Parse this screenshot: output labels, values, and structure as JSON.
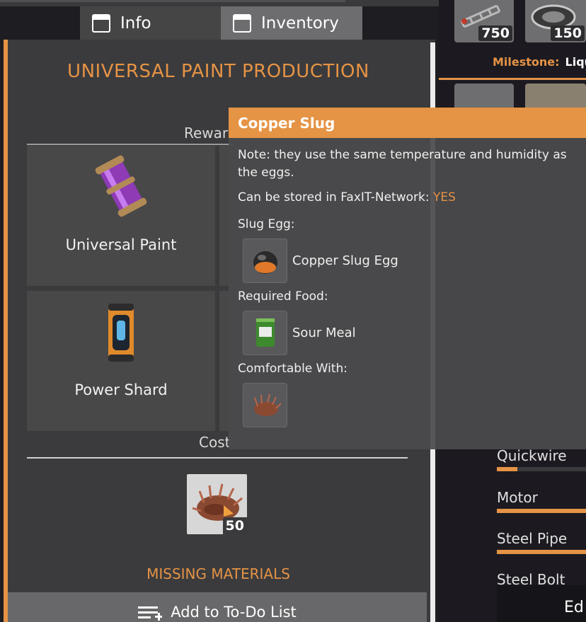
{
  "tabs": [
    {
      "label": "Info",
      "icon": "window-icon"
    },
    {
      "label": "Inventory",
      "icon": "window-icon"
    }
  ],
  "panel": {
    "title": "UNIVERSAL PAINT PRODUCTION",
    "rewards_label": "Rewar",
    "rewards": [
      {
        "name": "Universal Paint",
        "icon": "paint-canister-icon"
      },
      {
        "name": "Power Shard",
        "icon": "power-shard-icon"
      }
    ],
    "cost_label": "Cost",
    "cost_item": {
      "icon": "copper-slug-icon",
      "count": "50"
    },
    "missing_materials": "MISSING MATERIALS",
    "todo_button": "Add to To-Do List"
  },
  "tooltip": {
    "title": "Copper Slug",
    "note": "Note: they use the same temperature and humidity as the eggs.",
    "storage_label": "Can be stored in FaxIT-Network: ",
    "storage_value": "YES",
    "slug_egg_label": "Slug Egg:",
    "slug_egg_item": "Copper Slug Egg",
    "food_label": "Required Food:",
    "food_item": "Sour Meal",
    "comfort_label": "Comfortable With:",
    "comfort_icon": "copper-slug-icon"
  },
  "right_panel": {
    "top_items": [
      {
        "icon": "truss-frame-icon",
        "count": "750"
      },
      {
        "icon": "engine-part-icon",
        "count": "150"
      }
    ],
    "milestone_label": "Milestone:",
    "milestone_value": "Liqu",
    "progress_items": [
      {
        "name": "Quickwire",
        "progress": 0.23
      },
      {
        "name": "Motor",
        "progress": 1.0
      },
      {
        "name": "Steel Pipe",
        "progress": 1.0
      },
      {
        "name": "Steel Bolt",
        "progress": 1.0
      }
    ],
    "edge_text": "Ed"
  },
  "colors": {
    "accent": "#e59345",
    "panel": "#3b3b3d",
    "card": "#484849",
    "tooltip_bg": "#4a4a4c"
  }
}
